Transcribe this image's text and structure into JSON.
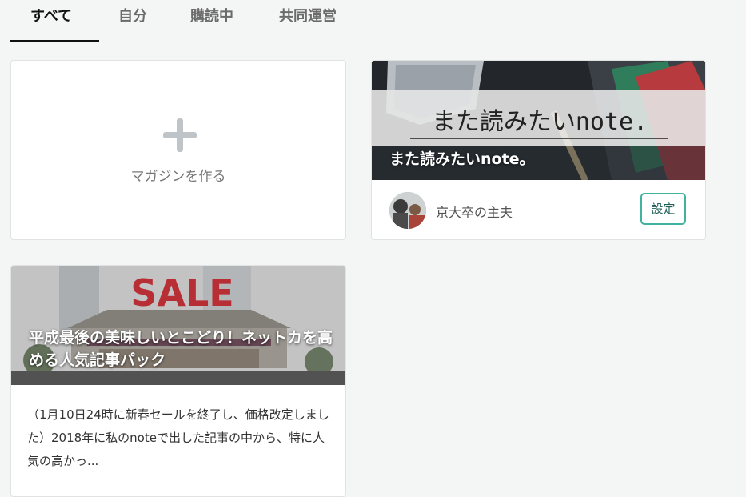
{
  "tabs": [
    {
      "label": "すべて",
      "active": true
    },
    {
      "label": "自分",
      "active": false
    },
    {
      "label": "購読中",
      "active": false
    },
    {
      "label": "共同運営",
      "active": false
    }
  ],
  "create_card": {
    "label": "マガジンを作る",
    "icon": "plus-icon"
  },
  "magazine_card": {
    "cover_text": "また読みたいnote.",
    "title": "また読みたいnote。",
    "author": "京大卒の主夫",
    "settings_label": "設定"
  },
  "sale_card": {
    "cover_text": "SALE",
    "title": "平成最後の美味しいとこどり！ネットカを高める人気記事パック",
    "description": "（1月10日24時に新春セールを終了し、価格改定しました）2018年に私のnoteで出した記事の中から、特に人気の高かっ..."
  },
  "colors": {
    "accent": "#3fb3a0",
    "sale_red": "#c8323a",
    "background": "#f4f5f5"
  }
}
